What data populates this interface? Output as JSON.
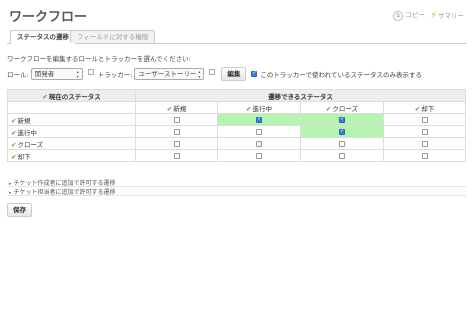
{
  "page": {
    "title": "ワークフロー"
  },
  "context": {
    "copy": "コピー",
    "summary": "サマリー"
  },
  "tabs": [
    {
      "label": "ステータスの遷移",
      "active": true
    },
    {
      "label": "フィールドに対する権限",
      "active": false
    }
  ],
  "description": "ワークフローを編集するロールとトラッカーを選んでください:",
  "filter": {
    "role_label": "ロール:",
    "role_value": "開発者",
    "tracker_label": "トラッカー:",
    "tracker_value": "ユーザーストーリー",
    "edit_button": "編集",
    "used_only_label": "このトラッカーで使われているステータスのみ表示する",
    "used_only_checked": true
  },
  "table": {
    "current_header": "現在のステータス",
    "allowed_header": "遷移できるステータス",
    "columns": [
      "新規",
      "進行中",
      "クローズ",
      "却下"
    ],
    "rows": [
      {
        "status": "新規",
        "cells": [
          false,
          true,
          true,
          false
        ],
        "highlight": [
          false,
          true,
          true,
          false
        ]
      },
      {
        "status": "進行中",
        "cells": [
          false,
          false,
          true,
          false
        ],
        "highlight": [
          false,
          false,
          true,
          false
        ]
      },
      {
        "status": "クローズ",
        "cells": [
          false,
          false,
          false,
          false
        ],
        "highlight": [
          false,
          false,
          false,
          false
        ]
      },
      {
        "status": "却下",
        "cells": [
          false,
          false,
          false,
          false
        ],
        "highlight": [
          false,
          false,
          false,
          false
        ]
      }
    ]
  },
  "sections": {
    "author": "チケット作成者に追加で許可する遷移",
    "assignee": "チケット担当者に追加で許可する遷移"
  },
  "save_button": "保存"
}
